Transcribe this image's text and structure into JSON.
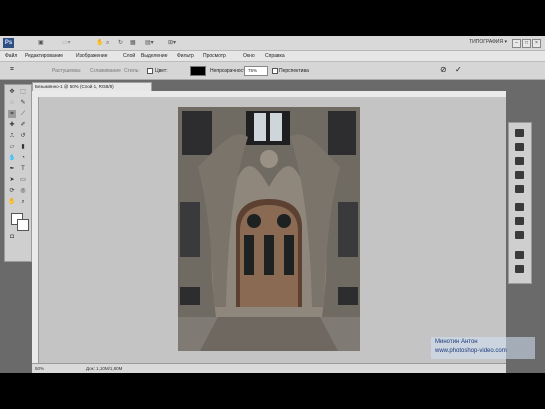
{
  "app": {
    "logo": "Ps",
    "workspace": "ТИПОГРАФИЯ ▾",
    "minimize": "–",
    "maximize": "□",
    "close": "×"
  },
  "menu": [
    "Файл",
    "Редактирование",
    "Изображение",
    "Слой",
    "Выделение",
    "Фильтр",
    "Просмотр",
    "Окно",
    "Справка"
  ],
  "options": {
    "feather_label": "Растушевка:",
    "antialias": "Сглаживание",
    "edge_label": "Стиль:",
    "color_label": "Цвет:",
    "opacity_label": "Непрозрачность:",
    "opacity_value": "75%",
    "persp_label": "Перспектива",
    "cancel_icon": "cancel-icon",
    "commit_icon": "check-icon"
  },
  "document": {
    "tab_title": "Безымянно-1 @ 50% (Слой 1, RGB/8)",
    "zoom": "50%",
    "doc_info": "Док: 1,10M/1,80M"
  },
  "watermark": {
    "line1": "Минотин Антон",
    "line2": "www.photoshop-video.com"
  },
  "colors": {
    "canvas": "#c4c4c4",
    "chrome": "#d6d6d6",
    "accent": "#2d4f82"
  }
}
